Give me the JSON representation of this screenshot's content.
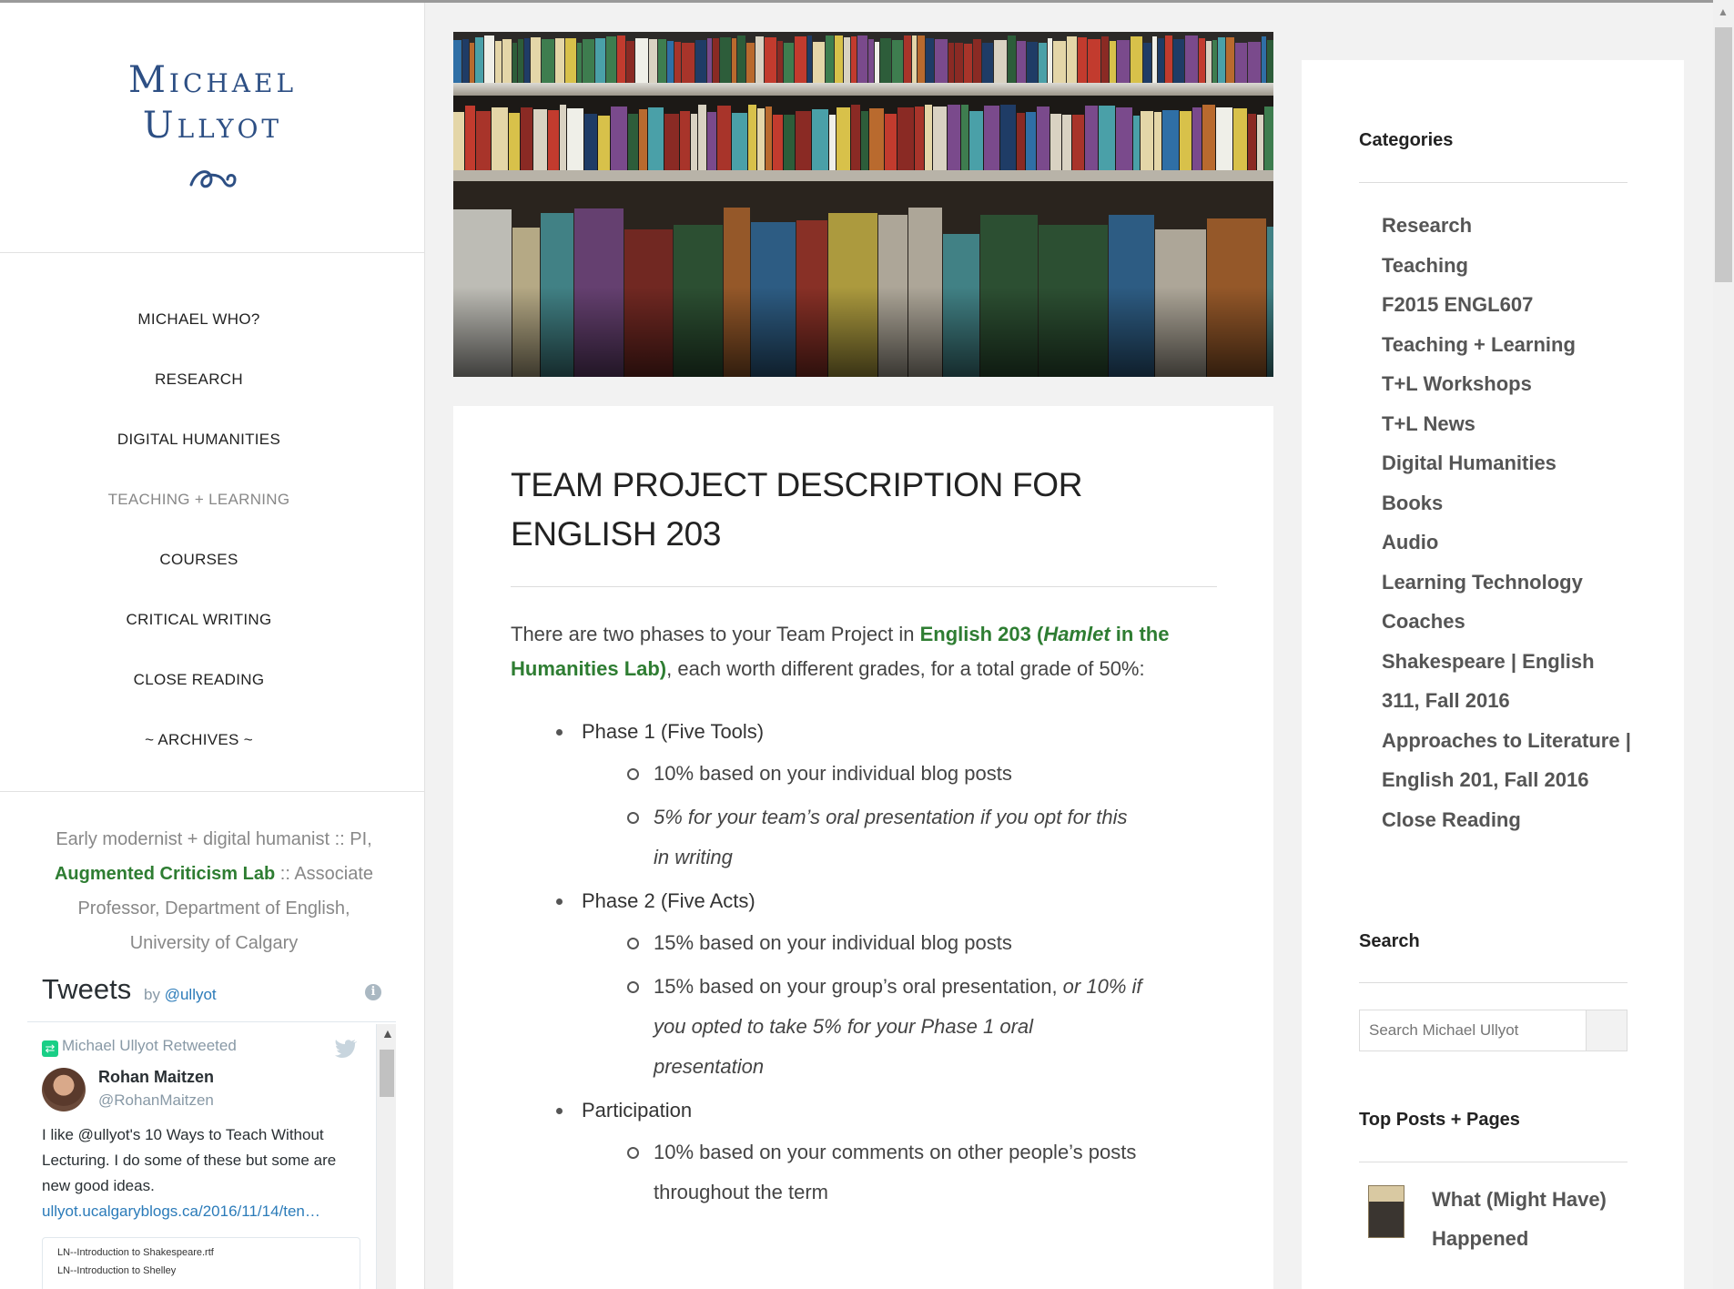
{
  "site": {
    "title_line1": "Michael",
    "title_line2": "Ullyot"
  },
  "nav": {
    "items": [
      {
        "label": "Michael who?"
      },
      {
        "label": "Research"
      },
      {
        "label": "Digital Humanities"
      },
      {
        "label": "Teaching + Learning"
      },
      {
        "label": "Courses"
      },
      {
        "label": "Critical Writing"
      },
      {
        "label": "Close Reading"
      },
      {
        "label": "~ Archives ~"
      }
    ]
  },
  "bio": {
    "text_before": "Early modernist + digital humanist :: PI,",
    "link": "Augmented Criticism Lab",
    "text_after": ":: Associate Professor, Department of English, University of Calgary"
  },
  "tweets": {
    "title": "Tweets",
    "by": "by",
    "handle": "@ullyot",
    "retweeted": "Michael Ullyot Retweeted",
    "author_name": "Rohan Maitzen",
    "author_handle": "@RohanMaitzen",
    "text": "I like @ullyot's 10 Ways to Teach Without Lecturing. I do some of these but some are new good ideas.",
    "link": "ullyot.ucalgaryblogs.ca/2016/11/14/ten…",
    "card_line1": "LN--Introduction to Shakespeare.rtf",
    "card_line2": "LN--Introduction to Shelley"
  },
  "article": {
    "title": "Team Project Description for English 203",
    "intro_before": "There are two phases to your Team Project in ",
    "intro_link_a": "English 203 (",
    "intro_link_em": "Hamlet",
    "intro_link_b": " in the Humanities Lab)",
    "intro_after": ", each worth different grades, for a total grade of 50%:",
    "phase1": {
      "label": "Phase 1 (Five Tools)",
      "item1": "10% based on your individual blog posts",
      "item2": "5% for your team’s oral presentation if you opt for this in writing"
    },
    "phase2": {
      "label": "Phase 2 (Five Acts)",
      "item1": "15% based on your individual blog posts",
      "item2_a": "15% based on your group’s oral presentation, ",
      "item2_b": "or 10% if you opted to take 5% for your Phase 1 oral presentation"
    },
    "participation": {
      "label": "Participation",
      "item1": "10% based on your comments on other people’s posts throughout the term"
    }
  },
  "sidebar": {
    "categories_title": "Categories",
    "categories": [
      "Research",
      "Teaching",
      "F2015 ENGL607",
      "Teaching + Learning",
      "T+L Workshops",
      "T+L News",
      "Digital Humanities",
      "Books",
      "Audio",
      "Learning Technology",
      "Coaches",
      "Shakespeare | English 311, Fall 2016",
      "Approaches to Literature | English 201, Fall 2016",
      "Close Reading"
    ],
    "search_title": "Search",
    "search_placeholder": "Search Michael Ullyot",
    "top_posts_title": "Top Posts + Pages",
    "top_post": "What (Might Have) Happened"
  },
  "colors": {
    "title_blue": "#2d4f84",
    "link_green": "#2e7d32",
    "twitter_blue": "#2b7bb9"
  }
}
